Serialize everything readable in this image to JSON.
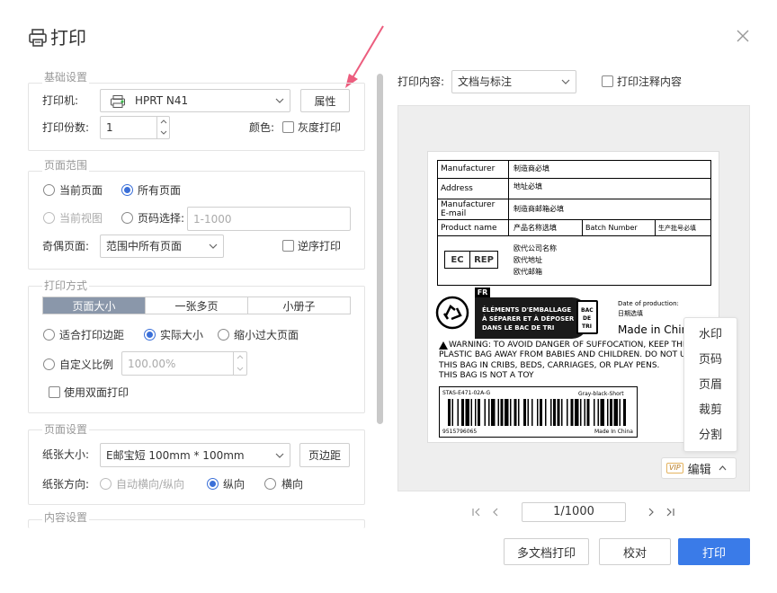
{
  "dialog": {
    "title": "打印"
  },
  "basic": {
    "group_label": "基础设置",
    "printer_label": "打印机:",
    "printer_value": "HPRT N41",
    "properties_button": "属性",
    "copies_label": "打印份数:",
    "copies_value": "1",
    "color_label": "颜色:",
    "grayscale_label": "灰度打印"
  },
  "range": {
    "group_label": "页面范围",
    "current_page": "当前页面",
    "all_pages": "所有页面",
    "current_view": "当前视图",
    "page_select": "页码选择:",
    "page_select_placeholder": "1-1000",
    "odd_even_label": "奇偶页面:",
    "odd_even_value": "范围中所有页面",
    "reverse_label": "逆序打印"
  },
  "method": {
    "group_label": "打印方式",
    "tabs": [
      "页面大小",
      "一张多页",
      "小册子"
    ],
    "fit_margin": "适合打印边距",
    "actual_size": "实际大小",
    "shrink_oversize": "缩小过大页面",
    "custom_scale": "自定义比例",
    "custom_scale_value": "100.00%",
    "duplex_label": "使用双面打印"
  },
  "page_setup": {
    "group_label": "页面设置",
    "paper_size_label": "纸张大小:",
    "paper_size_value": "E邮宝短 100mm * 100mm",
    "margin_button": "页边距",
    "orientation_label": "纸张方向:",
    "auto_orientation": "自动横向/纵向",
    "portrait": "纵向",
    "landscape": "横向"
  },
  "content_setup": {
    "group_label": "内容设置"
  },
  "right": {
    "print_content_label": "打印内容:",
    "print_content_value": "文档与标注",
    "print_annotation_label": "打印注释内容"
  },
  "label": {
    "rows": [
      {
        "k": "Manufacturer",
        "v": "制造商必填"
      },
      {
        "k": "Address",
        "v": "地址必填"
      },
      {
        "k": "Manufacturer E-mail",
        "v": "制造商邮箱必填"
      }
    ],
    "product_name": "Product name",
    "product_name_value": "产品名称选填",
    "batch_number": "Batch Number",
    "production_batch": "生产批号必填",
    "ec": "EC",
    "rep": "REP",
    "eu_rows": [
      "欧代公司名称",
      "欧代地址",
      "欧代邮箱"
    ],
    "fr_tag": "FR",
    "fr_lines": [
      "ÉLÉMENTS D'EMBALLAGE",
      "À SÉPARER ET À DÉPOSER",
      "DANS LE BAC DE TRI"
    ],
    "bac_lines": [
      "BAC",
      "DE",
      "TRI"
    ],
    "date_of_production": "Date of production:",
    "date_value": "日期选填",
    "made_in": "Made in Chin",
    "warning_lines": [
      "WARNING: TO AVOID DANGER OF SUFFOCATION, KEEP THIS",
      "PLASTIC BAG AWAY FROM BABIES AND CHILDREN. DO NOT US",
      "THIS BAG IN CRIBS, BEDS, CARRIAGES, OR PLAY PENS.",
      "THIS BAG IS NOT A TOY"
    ],
    "barcode_sku": "STAS-E471-02A-G",
    "barcode_variant": "Gray-black-Short",
    "barcode_number": "9515796065",
    "barcode_made": "Made In China"
  },
  "menu": {
    "items": [
      "水印",
      "页码",
      "页眉",
      "裁剪",
      "分割"
    ]
  },
  "edit_badge": {
    "vip": "VIP",
    "label": "编辑"
  },
  "pager": {
    "value": "1/1000"
  },
  "footer": {
    "multi_doc": "多文档打印",
    "proof": "校对",
    "print": "打印"
  },
  "colors": {
    "primary": "#3a7be8",
    "tab_active": "#8a97aa",
    "arrow": "#ec5d7e"
  }
}
